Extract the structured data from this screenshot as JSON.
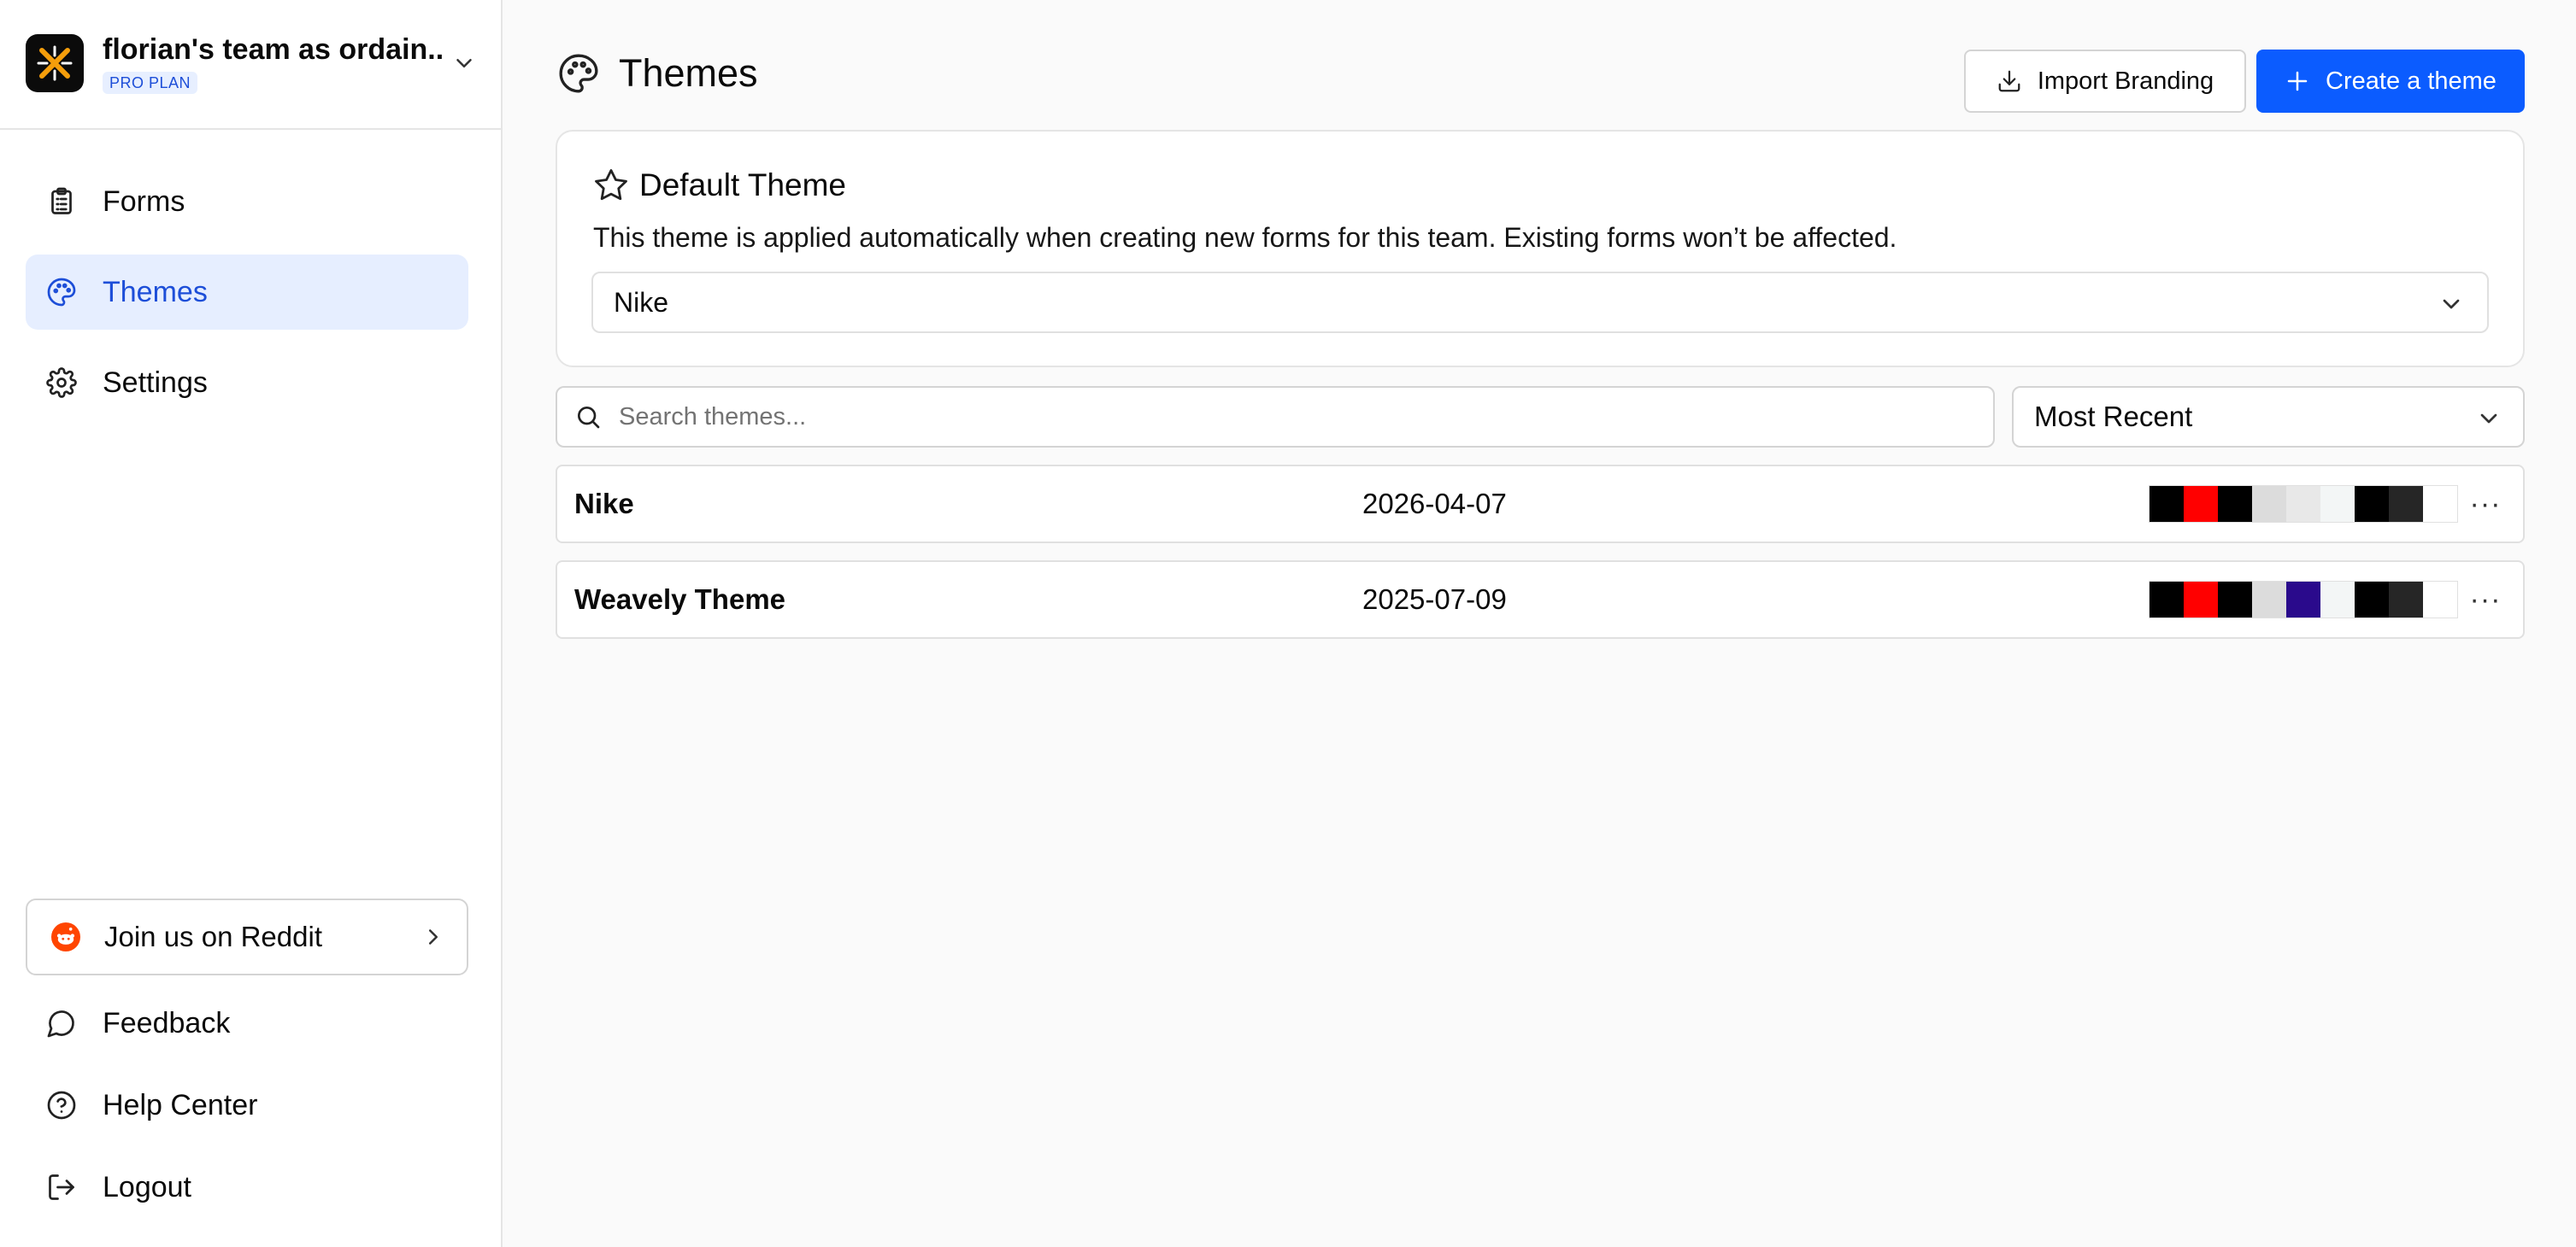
{
  "team": {
    "name": "florian's team as ordain...",
    "plan": "PRO PLAN"
  },
  "nav": {
    "items": [
      {
        "label": "Forms",
        "icon": "clipboard-icon",
        "active": false
      },
      {
        "label": "Themes",
        "icon": "palette-icon",
        "active": true
      },
      {
        "label": "Settings",
        "icon": "gear-icon",
        "active": false
      }
    ]
  },
  "footer": {
    "reddit_label": "Join us on Reddit",
    "feedback_label": "Feedback",
    "help_label": "Help Center",
    "logout_label": "Logout"
  },
  "header": {
    "title": "Themes",
    "import_label": "Import Branding",
    "create_label": "Create a theme"
  },
  "default_theme": {
    "title": "Default Theme",
    "description": "This theme is applied automatically when creating new forms for this team. Existing forms won’t be affected.",
    "selected": "Nike"
  },
  "search": {
    "placeholder": "Search themes..."
  },
  "sort": {
    "selected": "Most Recent"
  },
  "themes": [
    {
      "name": "Nike",
      "date": "2026-04-07",
      "swatches": [
        "#000000",
        "#ff0000",
        "#000000",
        "#dcdcdc",
        "#e8e8e8",
        "#f3f6f6",
        "#000000",
        "#262626",
        "#ffffff"
      ]
    },
    {
      "name": "Weavely Theme",
      "date": "2025-07-09",
      "swatches": [
        "#000000",
        "#ff0000",
        "#000000",
        "#dcdcdc",
        "#2a0a8c",
        "#f3f6f6",
        "#000000",
        "#262626",
        "#ffffff"
      ]
    }
  ],
  "colors": {
    "accent": "#0b5cff",
    "active_nav_bg": "#e6eeff",
    "active_nav_text": "#1d4ed8",
    "reddit": "#ff4500"
  }
}
